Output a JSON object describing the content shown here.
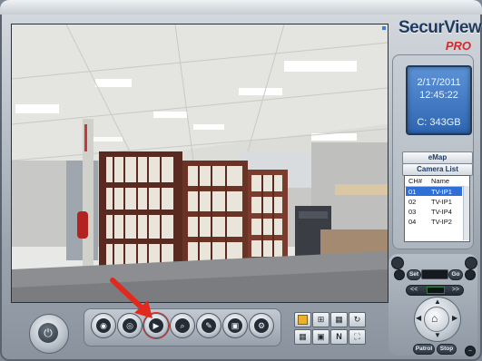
{
  "app": {
    "brand_name": "SecurView",
    "brand_edition": "PRO"
  },
  "status_display": {
    "date": "2/17/2011",
    "time": "12:45:22",
    "capacity": "C: 343GB"
  },
  "panel": {
    "emap_label": "eMap",
    "camera_list_label": "Camera List"
  },
  "camera_list": {
    "columns": [
      "CH#",
      "Name"
    ],
    "rows": [
      {
        "ch": "01",
        "name": "TV-IP1",
        "selected": true
      },
      {
        "ch": "02",
        "name": "TV-IP1",
        "selected": false
      },
      {
        "ch": "03",
        "name": "TV-IP4",
        "selected": false
      },
      {
        "ch": "04",
        "name": "TV-IP2",
        "selected": false
      }
    ]
  },
  "ptz": {
    "set_label": "Set",
    "go_label": "Go",
    "zoom_out_label": "<<",
    "zoom_in_label": ">>",
    "patrol_label": "Patrol",
    "stop_label": "Stop"
  },
  "toolbar": {
    "buttons": [
      {
        "name": "record-settings",
        "icon": "disc-icon",
        "glyph": "◉"
      },
      {
        "name": "camera-view",
        "icon": "eye-icon",
        "glyph": "◎"
      },
      {
        "name": "playback",
        "icon": "play-icon",
        "glyph": "▶"
      },
      {
        "name": "search",
        "icon": "magnifier-icon",
        "glyph": "⌕"
      },
      {
        "name": "edit",
        "icon": "pencil-icon",
        "glyph": "✎"
      },
      {
        "name": "backup",
        "icon": "archive-icon",
        "glyph": "▣"
      },
      {
        "name": "settings",
        "icon": "gear-icon",
        "glyph": "⚙"
      }
    ],
    "highlighted": "playback"
  },
  "layouts": {
    "n_label": "N"
  },
  "colors": {
    "selection": "#2f6fd6",
    "lcd": "#3f79c6",
    "brand_pro": "#d42a2a",
    "annotation_arrow": "#e02a1f"
  }
}
